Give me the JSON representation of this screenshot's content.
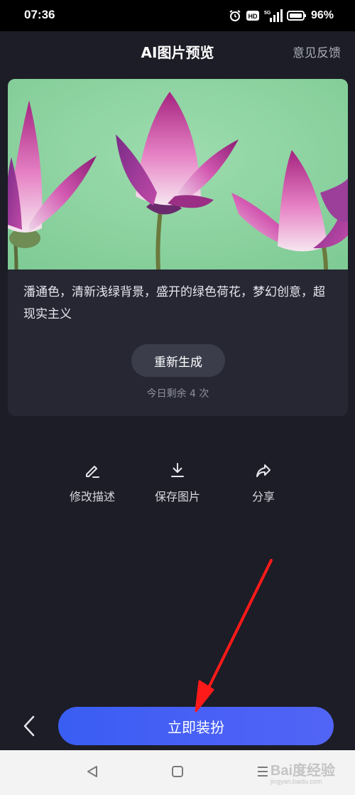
{
  "status_bar": {
    "time": "07:36",
    "network": "5G",
    "hd_badge": "HD",
    "battery": "96%",
    "icons": [
      "alarm-icon",
      "hd-icon",
      "signal-icon",
      "battery-icon"
    ]
  },
  "header": {
    "title": "AI图片预览",
    "feedback": "意见反馈"
  },
  "card": {
    "image": "lotus-preview-image",
    "prompt": "潘通色，清新浅绿背景，盛开的绿色荷花，梦幻创意，超现实主义",
    "regenerate_label": "重新生成",
    "remaining": "今日剩余 4 次"
  },
  "actions": [
    {
      "label": "修改描述",
      "icon": "edit-icon"
    },
    {
      "label": "保存图片",
      "icon": "download-icon"
    },
    {
      "label": "分享",
      "icon": "share-icon"
    }
  ],
  "bottom": {
    "primary_label": "立即装扮",
    "back_icon": "chevron-left-icon"
  },
  "nav_bar": {
    "icons": [
      "nav-back-icon",
      "nav-home-icon",
      "nav-menu-icon"
    ]
  },
  "watermark": {
    "text": "Bai度经验",
    "sub": "jingyan.baidu.com"
  },
  "colors": {
    "background": "#1c1d26",
    "card": "#262733",
    "primary_button": "#4a60f6",
    "annotation": "#ff1a1a"
  }
}
